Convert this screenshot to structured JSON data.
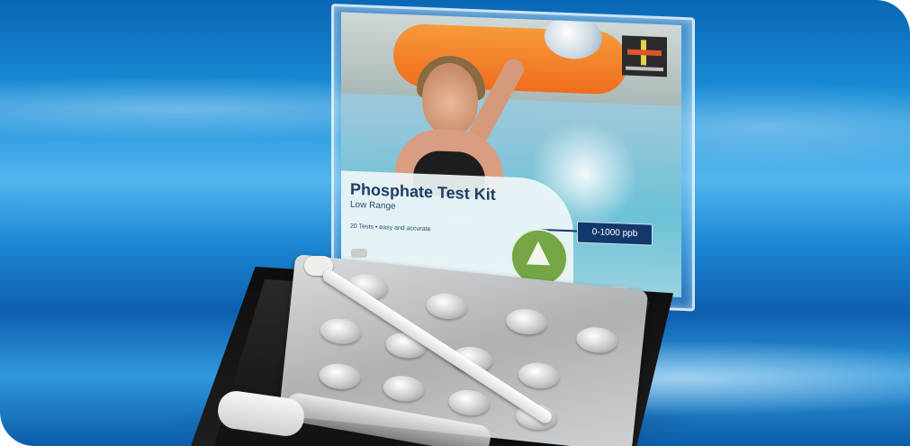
{
  "image": {
    "subject": "photo",
    "colors": {
      "background": "#1a8fd8",
      "box": "#111111",
      "label_title": "#1c3f63",
      "range_box": "#13386a",
      "badge": "#74a646"
    }
  },
  "product": {
    "title": "Phosphate Test Kit",
    "subtitle": "Low Range",
    "tests": "20 Tests • easy and accurate",
    "range": "0-1000 ppb"
  }
}
